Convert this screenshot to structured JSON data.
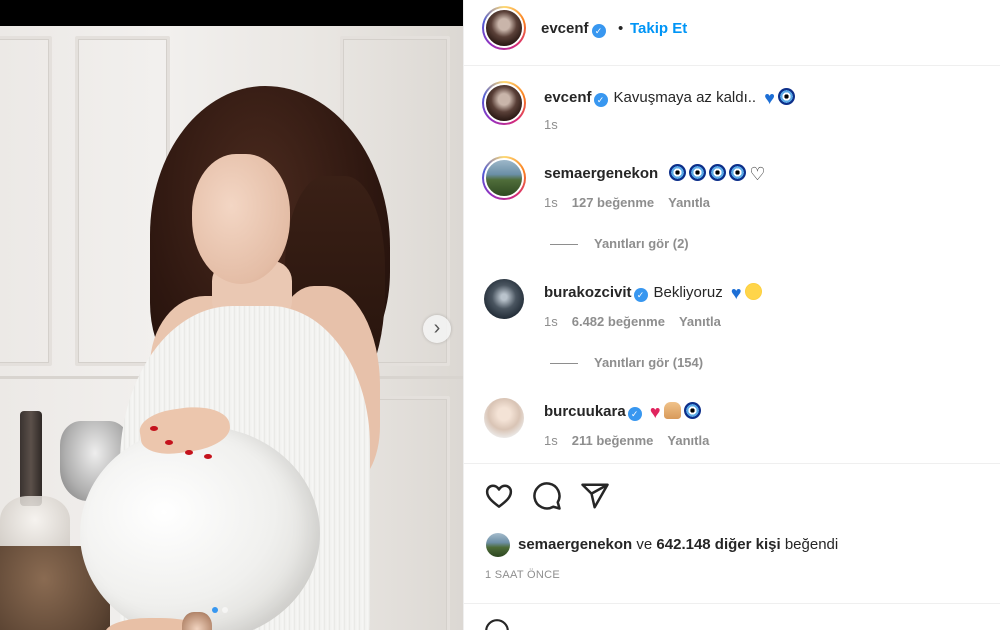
{
  "post": {
    "author": "evcenf",
    "follow_label": "Takip Et",
    "bullet": "•",
    "caption": "Kavuşmaya az kaldı..",
    "caption_time": "1s",
    "verified_mark": "✓",
    "slide_count": 2,
    "active_slide": 1,
    "next_arrow": "›"
  },
  "comments": [
    {
      "username": "semaergenekon",
      "verified": false,
      "text": "",
      "emojis": [
        "evil-eye",
        "evil-eye",
        "evil-eye",
        "evil-eye",
        "white-heart"
      ],
      "time": "1s",
      "likes": "127 beğenme",
      "reply": "Yanıtla",
      "view_replies": "Yanıtları gör (2)"
    },
    {
      "username": "burakozcivit",
      "verified": true,
      "text": "Bekliyoruz",
      "emojis": [
        "blue-heart",
        "smiling-face"
      ],
      "time": "1s",
      "likes": "6.482 beğenme",
      "reply": "Yanıtla",
      "view_replies": "Yanıtları gör (154)"
    },
    {
      "username": "burcuukara",
      "verified": true,
      "text": "",
      "emojis": [
        "red-heart",
        "folded-hands",
        "evil-eye"
      ],
      "time": "1s",
      "likes": "211 beğenme",
      "reply": "Yanıtla"
    }
  ],
  "actions": {
    "like_icon": "heart-outline-icon",
    "comment_icon": "comment-bubble-icon",
    "share_icon": "paper-plane-icon"
  },
  "likes": {
    "liker": "semaergenekon",
    "connector": "ve",
    "others": "642.148 diğer kişi",
    "suffix": "beğendi"
  },
  "posted_ago": "1 SAAT ÖNCE",
  "colors": {
    "accent": "#0095f6",
    "verified": "#3897f0",
    "muted": "#8e8e8e",
    "text": "#262626"
  }
}
